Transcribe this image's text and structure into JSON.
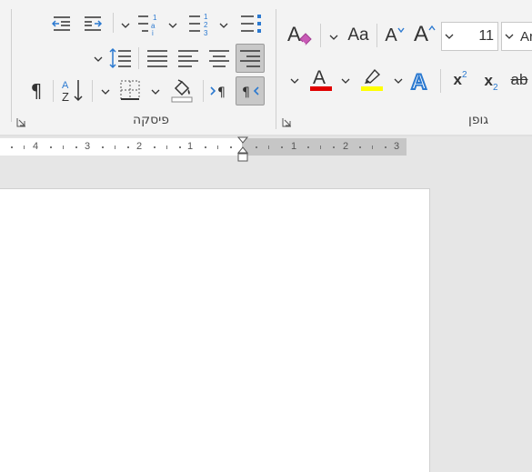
{
  "paragraph_group": {
    "label": "פיסקה"
  },
  "font_group": {
    "label": "גופן",
    "font_size": "11",
    "font_name": "Ar",
    "change_case_label": "Aa",
    "grow_font_label": "A",
    "shrink_font_label": "A",
    "superscript_label": "x",
    "superscript_sup": "2",
    "subscript_label": "x",
    "subscript_sub": "2",
    "strikethrough_label": "ab",
    "font_color": "#e00000",
    "highlight_color": "#ffff00"
  },
  "ruler": {
    "left_numbers": [
      "4",
      "3",
      "2",
      "1"
    ],
    "right_numbers": [
      "1",
      "2",
      "3"
    ]
  },
  "colors": {
    "accent": "#2b79d0",
    "ribbon_bg": "#f3f3f3"
  }
}
